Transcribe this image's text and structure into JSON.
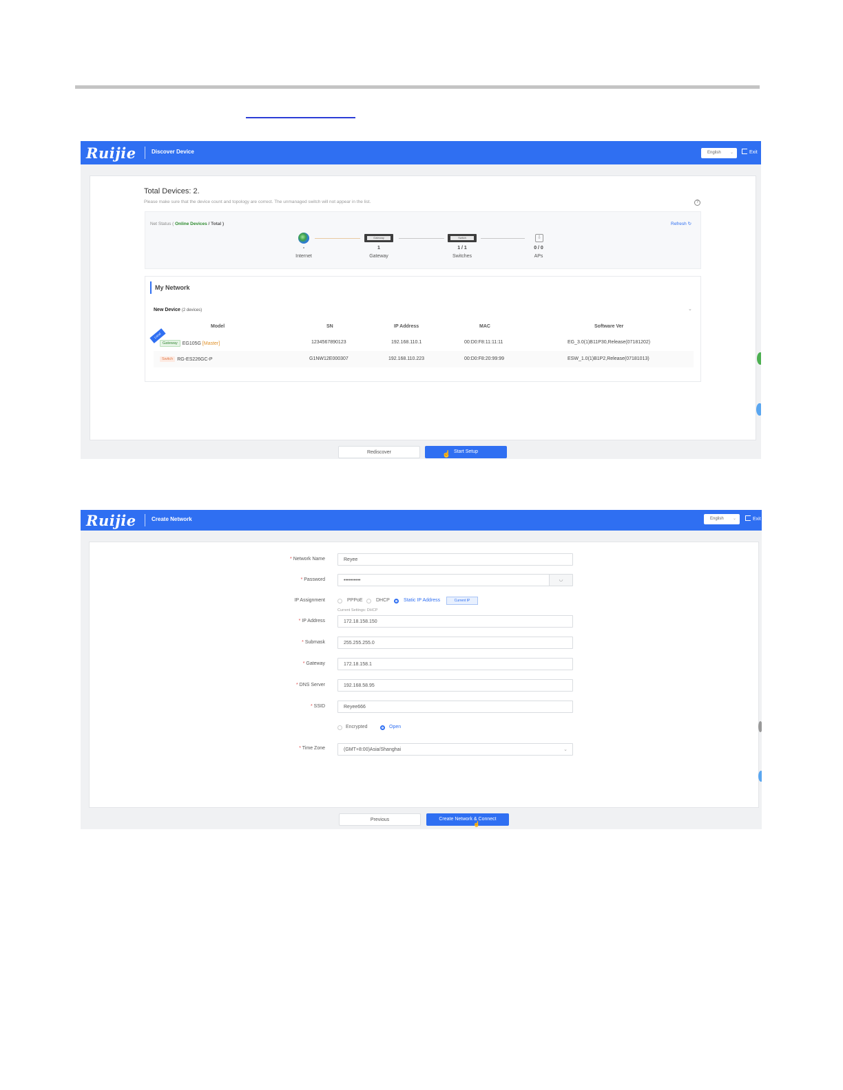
{
  "colors": {
    "brand": "#2f6ff2",
    "online": "#2e8b2e",
    "master": "#e0912a",
    "required": "#e04b4b"
  },
  "discover": {
    "logo": "Ruijie",
    "title": "Discover Device",
    "lang": "English",
    "exit": "Exit",
    "total": "Total Devices: 2.",
    "hint": "Please make sure that the device count and topology are correct. The unmanaged switch will not appear in the list.",
    "net_status_prefix": "Net Status ( ",
    "online_devices": "Online Devices",
    "net_status_sep": " / ",
    "net_status_total": "Total",
    "net_status_suffix": " )",
    "refresh": "Refresh",
    "topology": [
      {
        "value": "-",
        "label": "Internet",
        "icon": "globe-icon"
      },
      {
        "value": "1",
        "label": "Gateway",
        "icon": "gateway-icon",
        "badge": "Gateway"
      },
      {
        "value": "1 / 1",
        "label": "Switches",
        "icon": "switch-icon",
        "badge": "Switch"
      },
      {
        "value": "0 / 0",
        "label": "APs",
        "icon": "ap-icon"
      }
    ],
    "my_network": "My Network",
    "new_device": "New Device",
    "new_device_count": "(2 devices)",
    "columns": [
      "Model",
      "SN",
      "IP Address",
      "MAC",
      "Software Ver"
    ],
    "rows": [
      {
        "tag": "Gateway",
        "model": "EG105G",
        "role": "[Master]",
        "sn": "1234567890123",
        "ip": "192.168.110.1",
        "mac": "00:D0:F8:11:11:11",
        "ver": "EG_3.0(1)B11P30,Release(07181202)",
        "ribbon": "Local"
      },
      {
        "tag": "Switch",
        "model": "RG-ES226GC-P",
        "role": "",
        "sn": "G1NW12E000307",
        "ip": "192.168.110.223",
        "mac": "00:D0:F8:20:99:99",
        "ver": "ESW_1.0(1)B1P2,Release(07181013)",
        "ribbon": ""
      }
    ],
    "rediscover": "Rediscover",
    "start_setup": "Start Setup"
  },
  "create": {
    "logo": "Ruijie",
    "title": "Create Network",
    "lang": "English",
    "exit": "Exit",
    "fields": {
      "network_name": {
        "label": "Network Name",
        "value": "Reyee"
      },
      "password": {
        "label": "Password",
        "value": "••••••••••"
      },
      "ip_assignment": {
        "label": "IP Assignment"
      },
      "ip_address": {
        "label": "IP Address",
        "value": "172.18.158.150"
      },
      "submask": {
        "label": "Submask",
        "value": "255.255.255.0"
      },
      "gateway": {
        "label": "Gateway",
        "value": "172.18.158.1"
      },
      "dns": {
        "label": "DNS Server",
        "value": "192.168.58.95"
      },
      "ssid": {
        "label": "SSID",
        "value": "Reyee666"
      },
      "time_zone": {
        "label": "Time Zone",
        "value": "(GMT+8:00)Asia/Shanghai"
      }
    },
    "ip_options": [
      "PPPoE",
      "DHCP",
      "Static IP Address"
    ],
    "ip_selected": "Static IP Address",
    "current_ip": "Current IP",
    "current_settings": "Current Settings: DHCP",
    "security_options": [
      "Encrypted",
      "Open"
    ],
    "security_selected": "Open",
    "previous": "Previous",
    "create_connect": "Create Network & Connect"
  }
}
